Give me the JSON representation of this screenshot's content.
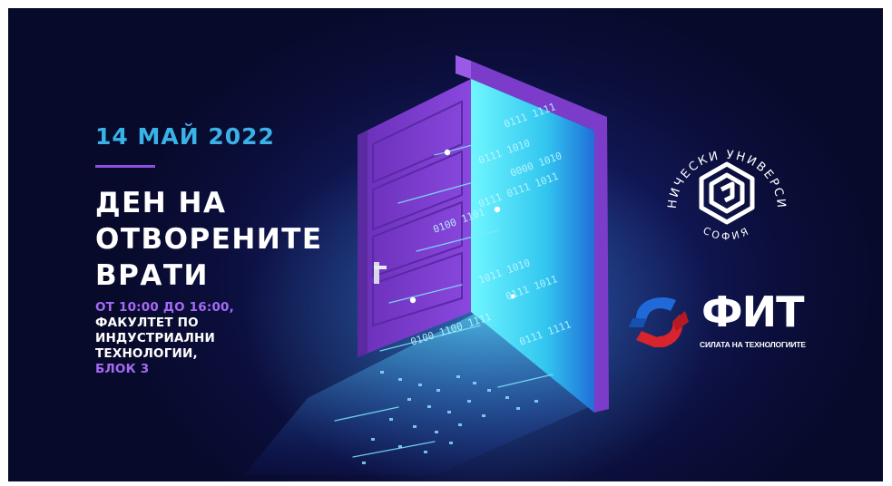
{
  "event": {
    "date": "14 МАЙ 2022",
    "title_lines": [
      "ДЕН НА",
      "ОТВОРЕНИТЕ",
      "ВРАТИ"
    ],
    "time": "ОТ 10:00 ДО 16:00,",
    "place_lines": [
      "ФАКУЛТЕТ ПО",
      "ИНДУСТРИАЛНИ",
      "ТЕХНОЛОГИИ,"
    ],
    "block": "БЛОК 3"
  },
  "door_code": [
    "0111 1111",
    "0111 1010",
    "0000 1010",
    "0111 0111 1011",
    "0100 1101",
    "1011 1010",
    "0111 1011",
    "0100 1100 1111",
    "0111 1111"
  ],
  "university_logo": {
    "ring_text": "ТЕХНИЧЕСКИ УНИВЕРСИТЕТ",
    "city": "СОФИЯ"
  },
  "faculty_logo": {
    "name": "ФИТ",
    "tagline": "СИЛАТА НА ТЕХНОЛОГИИТЕ"
  },
  "colors": {
    "background": "#0b0e3a",
    "date": "#3ab2e8",
    "accent": "#a46af5",
    "door": "#7b3cc9",
    "light": "#5ff0ff",
    "fit_blue": "#1f6ad8",
    "fit_red": "#d8242c"
  }
}
